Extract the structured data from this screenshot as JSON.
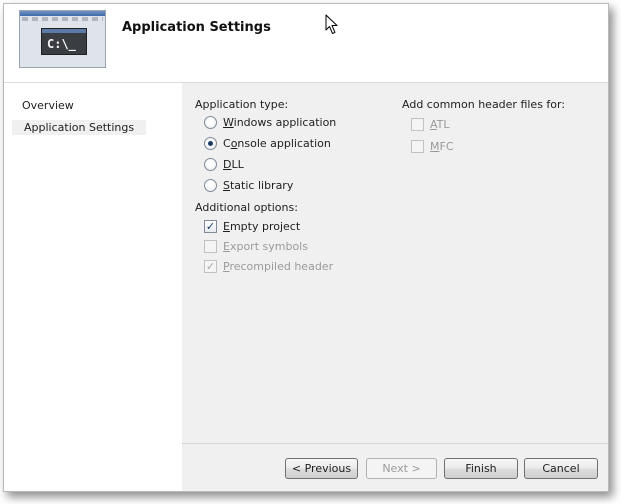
{
  "header": {
    "title": "Application Settings",
    "thumbnail": {
      "console_prompt": "C:\\_"
    }
  },
  "nav": {
    "items": [
      {
        "label": "Overview",
        "active": false
      },
      {
        "label": "Application Settings",
        "active": true
      }
    ]
  },
  "application_type": {
    "label": "Application type:",
    "options": [
      {
        "mnemonic": "W",
        "rest": "indows application",
        "checked": false
      },
      {
        "mnemonic": "",
        "pre": "C",
        "mid": "o",
        "rest": "nsole application",
        "checked": true
      },
      {
        "mnemonic": "D",
        "rest": "LL",
        "checked": false
      },
      {
        "mnemonic": "S",
        "rest": "tatic library",
        "checked": false
      }
    ]
  },
  "additional_options": {
    "label": "Additional options:",
    "options": [
      {
        "mnemonic": "E",
        "rest": "mpty project",
        "checked": true,
        "enabled": true
      },
      {
        "mnemonic": "E",
        "rest": "xport symbols",
        "checked": false,
        "enabled": false
      },
      {
        "mnemonic": "P",
        "rest": "recompiled header",
        "checked": true,
        "enabled": false
      }
    ]
  },
  "common_headers": {
    "label": "Add common header files for:",
    "options": [
      {
        "mnemonic": "A",
        "rest": "TL",
        "checked": false,
        "enabled": false
      },
      {
        "mnemonic": "M",
        "rest": "FC",
        "checked": false,
        "enabled": false
      }
    ]
  },
  "buttons": {
    "previous": "< Previous",
    "next": "Next >",
    "finish": "Finish",
    "cancel": "Cancel"
  },
  "icons": {
    "cursor": "mouse-pointer-icon",
    "check": "✓"
  }
}
